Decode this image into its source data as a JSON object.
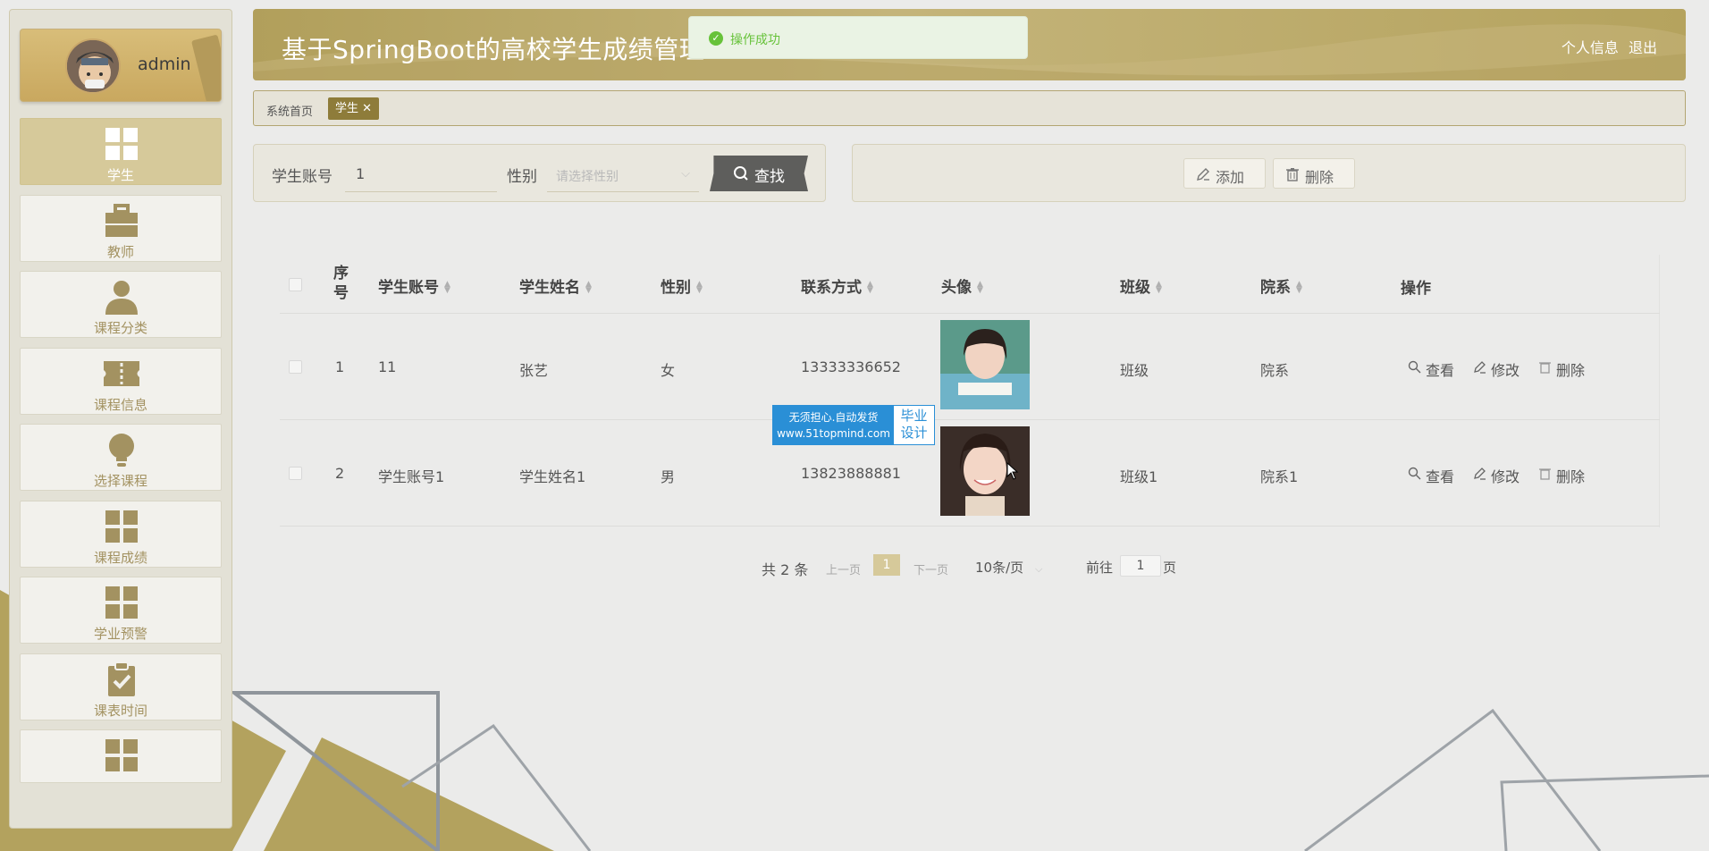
{
  "app": {
    "title": "基于SpringBoot的高校学生成绩管理",
    "header_links": [
      "个人信息",
      "退出"
    ]
  },
  "toast": {
    "text": "操作成功",
    "type": "success"
  },
  "user": {
    "name": "admin"
  },
  "sidebar": {
    "items": [
      {
        "label": "学生",
        "icon": "grid-icon",
        "active": true
      },
      {
        "label": "教师",
        "icon": "briefcase-icon",
        "active": false
      },
      {
        "label": "课程分类",
        "icon": "person-icon",
        "active": false
      },
      {
        "label": "课程信息",
        "icon": "ticket-icon",
        "active": false
      },
      {
        "label": "选择课程",
        "icon": "lightbulb-icon",
        "active": false
      },
      {
        "label": "课程成绩",
        "icon": "grid-icon",
        "active": false
      },
      {
        "label": "学业预警",
        "icon": "grid-icon",
        "active": false
      },
      {
        "label": "课表时间",
        "icon": "clipboard-check-icon",
        "active": false
      },
      {
        "label": "",
        "icon": "grid-icon",
        "active": false
      }
    ]
  },
  "breadcrumb": {
    "home": "系统首页",
    "current_tag": "学生"
  },
  "search": {
    "account_label": "学生账号",
    "account_value": "1",
    "gender_label": "性别",
    "gender_placeholder": "请选择性别",
    "search_button": "查找"
  },
  "actions": {
    "add": "添加",
    "delete": "删除"
  },
  "table": {
    "columns": [
      "序号",
      "学生账号",
      "学生姓名",
      "性别",
      "联系方式",
      "头像",
      "班级",
      "院系",
      "操作"
    ],
    "rows": [
      {
        "index": "1",
        "account": "11",
        "name": "张艺",
        "gender": "女",
        "phone": "13333336652",
        "class": "班级",
        "dept": "院系"
      },
      {
        "index": "2",
        "account": "学生账号1",
        "name": "学生姓名1",
        "gender": "男",
        "phone": "13823888881",
        "class": "班级1",
        "dept": "院系1"
      }
    ],
    "row_ops": [
      "查看",
      "修改",
      "删除"
    ]
  },
  "watermark": {
    "line1": "无须担心.自动发货",
    "line2": "www.51topmind.com",
    "right1": "毕业",
    "right2": "设计"
  },
  "pagination": {
    "total": "共 2 条",
    "prev": "上一页",
    "current": "1",
    "next": "下一页",
    "page_size": "10条/页",
    "goto_label": "前往",
    "goto_value": "1",
    "goto_suffix": "页"
  },
  "colors": {
    "accent": "#b19f5b",
    "accent_dark": "#8e7c3a",
    "active_nav": "#d6c99a",
    "success": "#67c23a"
  }
}
